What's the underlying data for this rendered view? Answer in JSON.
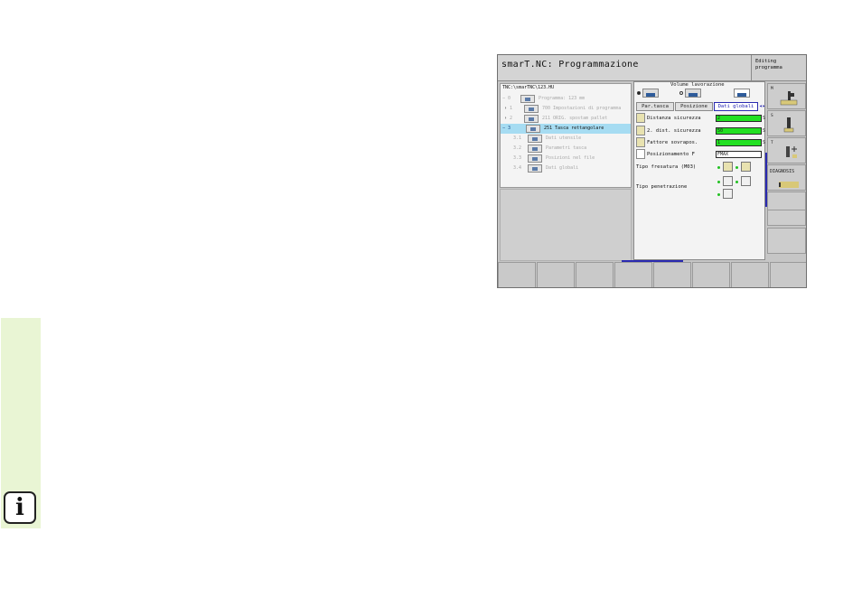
{
  "app": {
    "title": "smarT.NC: Programmazione",
    "mode": "Editing programma"
  },
  "tree": {
    "path": "TNC:\\smarTNC\\123.HU",
    "items": [
      {
        "num": "0",
        "label": "Programma: 123 mm",
        "toggle": "−",
        "state": "dim"
      },
      {
        "num": "1",
        "label": "700 Impostazioni di programma",
        "toggle": "›",
        "state": "dim"
      },
      {
        "num": "2",
        "label": "211 ORIG. spostam pallet",
        "toggle": "›",
        "state": "dim"
      },
      {
        "num": "3",
        "label": "251 Tasca rettangolare",
        "toggle": "−",
        "state": "selected"
      },
      {
        "num": "3.1",
        "label": "Dati utensile",
        "toggle": "",
        "state": "dim"
      },
      {
        "num": "3.2",
        "label": "Parametri tasca",
        "toggle": "",
        "state": "dim"
      },
      {
        "num": "3.3",
        "label": "Posizioni nel file",
        "toggle": "",
        "state": "dim"
      },
      {
        "num": "3.4",
        "label": "Dati globali",
        "toggle": "",
        "state": "dim"
      }
    ]
  },
  "form": {
    "volume_label": "Volume lavorazione",
    "tabs": [
      "Par.tasca",
      "Posizione",
      "Dati globali"
    ],
    "active_tab": 2,
    "fields": [
      {
        "label": "Distanza sicurezza",
        "value": "2",
        "unit": "S"
      },
      {
        "label": "2. dist. sicurezza",
        "value": "50",
        "unit": "S"
      },
      {
        "label": "Fattore sovrapos.",
        "value": "1",
        "unit": "S"
      },
      {
        "label": "Posizionamento F",
        "value": "FMAX",
        "unit": ""
      }
    ],
    "milling_type_label": "Tipo fresatura (M03)",
    "plunge_type_label": "Tipo penetrazione"
  },
  "softkeys": {
    "right": [
      "M",
      "S",
      "T",
      "DIAGNOSIS",
      "",
      "",
      ""
    ]
  },
  "side": {
    "info_glyph": "i"
  }
}
